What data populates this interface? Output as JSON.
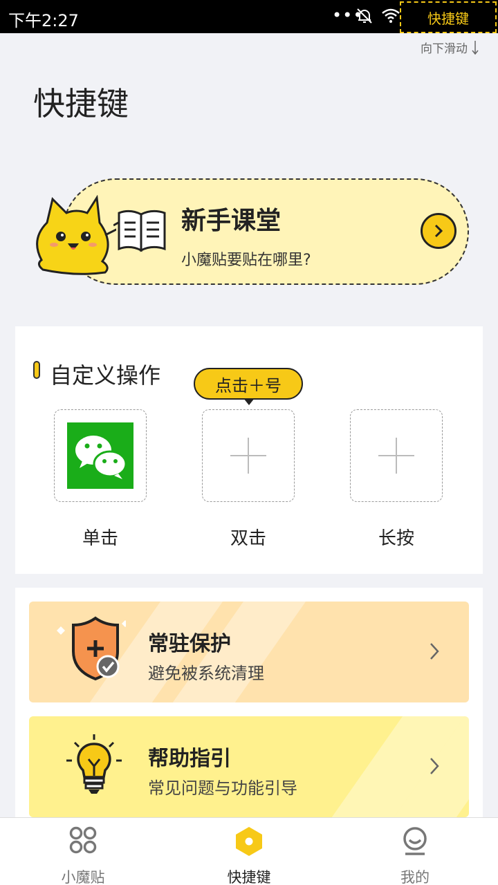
{
  "status_bar": {
    "time": "下午2:27",
    "overflow": "•••",
    "shortcut_label": "快捷键"
  },
  "scroll_hint": "向下滑动",
  "page_title": "快捷键",
  "banner": {
    "title": "新手课堂",
    "subtitle": "小魔贴要贴在哪里?"
  },
  "custom_section": {
    "title": "自定义操作",
    "tooltip": "点击＋号",
    "slots": [
      {
        "label": "单击",
        "assigned_app": "wechat-icon"
      },
      {
        "label": "双击",
        "assigned_app": ""
      },
      {
        "label": "长按",
        "assigned_app": ""
      }
    ]
  },
  "features": [
    {
      "title": "常驻保护",
      "subtitle": "避免被系统清理",
      "icon": "shield-icon",
      "color": "#ffe2ad"
    },
    {
      "title": "帮助指引",
      "subtitle": "常见问题与功能引导",
      "icon": "lightbulb-icon",
      "color": "#fff18e"
    }
  ],
  "bottom_nav": {
    "items": [
      {
        "label": "小魔贴",
        "icon": "grid-icon"
      },
      {
        "label": "快捷键",
        "icon": "hexagon-icon",
        "active": true
      },
      {
        "label": "我的",
        "icon": "profile-icon"
      }
    ]
  },
  "colors": {
    "accent": "#f7c917",
    "banner_bg": "#fff4b8",
    "page_bg": "#f1f2f6"
  }
}
